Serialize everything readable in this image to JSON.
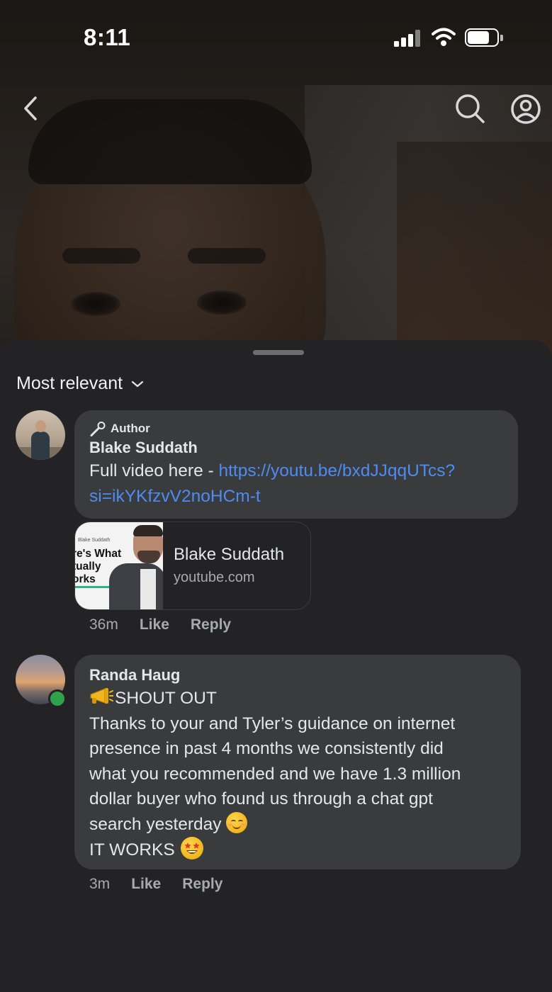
{
  "status_bar": {
    "time": "8:11"
  },
  "icons": {
    "back": "chevron-left-icon",
    "search": "search-icon",
    "profile": "profile-icon",
    "sort_chevron": "chevron-down-icon",
    "author_badge": "microphone-icon"
  },
  "sheet": {
    "sort_label": "Most relevant"
  },
  "comments": [
    {
      "author_badge": "Author",
      "name": "Blake Suddath",
      "text_prefix": "Full video here - ",
      "link_line1": "https://youtu.be/bxdJJqqUTcs?",
      "link_line2": "si=ikYKfzvV2noHCm-t",
      "link_preview": {
        "title": "Blake Suddath",
        "domain": "youtube.com",
        "thumb_channel": "Blake Suddath",
        "thumb_line1": "re's What",
        "thumb_line2": "tually",
        "thumb_line3": "orks"
      },
      "time": "36m",
      "like": "Like",
      "reply": "Reply"
    },
    {
      "name": "Randa Haug",
      "line1": "SHOUT OUT",
      "line2": "Thanks to your and Tyler’s  guidance on internet",
      "line3": "presence in past 4 months we consistently did",
      "line4": "what you recommended and we have 1.3 million",
      "line5": "dollar buyer who found us through a chat gpt",
      "line6": "search yesterday",
      "line7": "IT WORKS",
      "online": true,
      "time": "3m",
      "like": "Like",
      "reply": "Reply"
    }
  ],
  "colors": {
    "sheet_bg": "#232325",
    "bubble_bg": "#3a3b3d",
    "link": "#4c8cf3",
    "online": "#31a24c"
  }
}
